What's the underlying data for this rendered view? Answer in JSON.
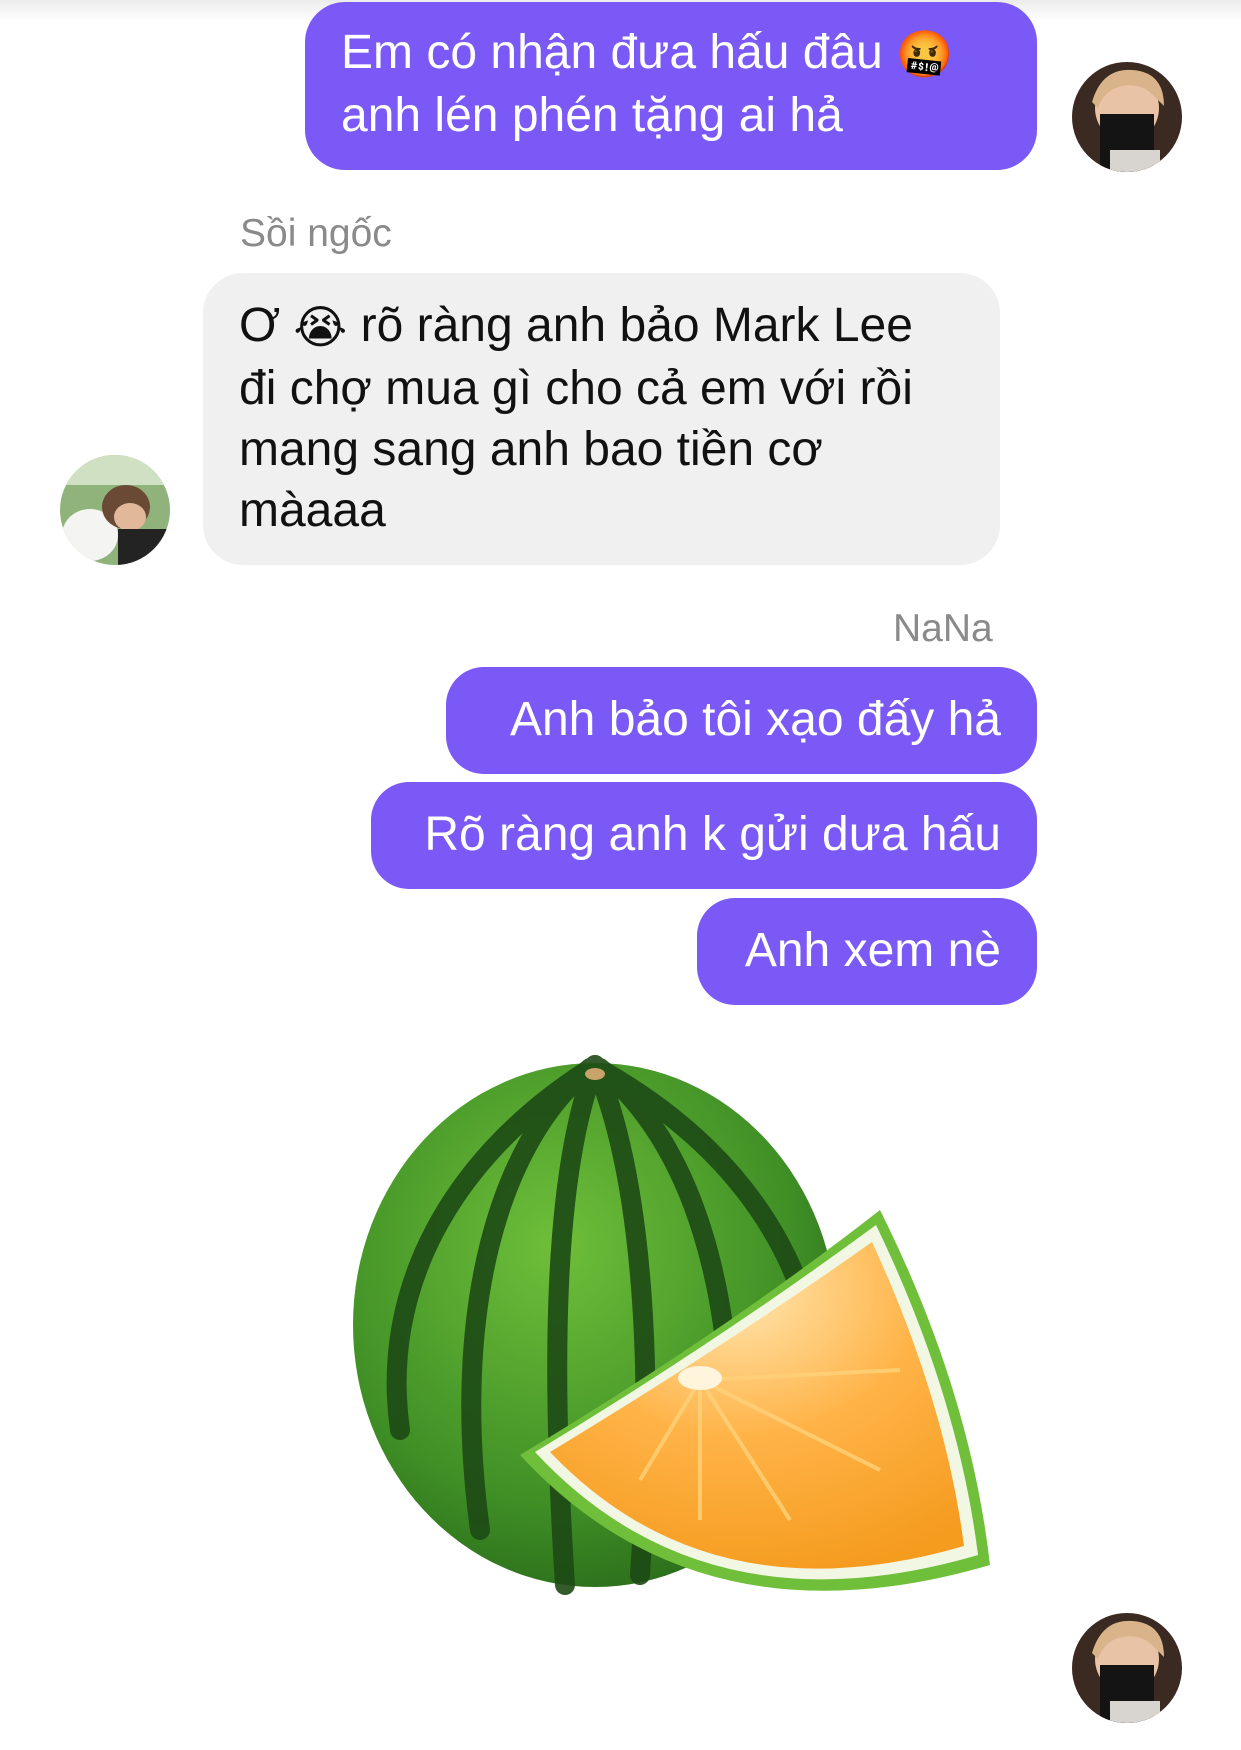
{
  "messages": [
    {
      "sender": "",
      "text": "Em có nhận đưa hấu đâu",
      "emoji": "🤬",
      "text2": "anh lén phén tặng ai hả"
    },
    {
      "sender": "Sồi ngốc",
      "text_start": "Ơ",
      "emoji": "😭",
      "text_rest": "rõ ràng anh bảo Mark Lee",
      "lines": [
        "đi chợ mua gì cho cả em với rồi",
        "mang sang anh bao tiền cơ",
        "màaaa"
      ]
    },
    {
      "sender": "NaNa",
      "text": "Anh bảo tôi xạo đấy hả"
    },
    {
      "text": "Rõ ràng anh k gửi dưa hấu"
    },
    {
      "text": "Anh xem nè"
    }
  ],
  "colors": {
    "outgoing": "#7b59f6",
    "incoming": "#f0f0f0",
    "sender_label": "#8a8a8a"
  },
  "icons": [
    "avatar-me",
    "avatar-soi-ngoc",
    "watermelon-orange-photo"
  ]
}
